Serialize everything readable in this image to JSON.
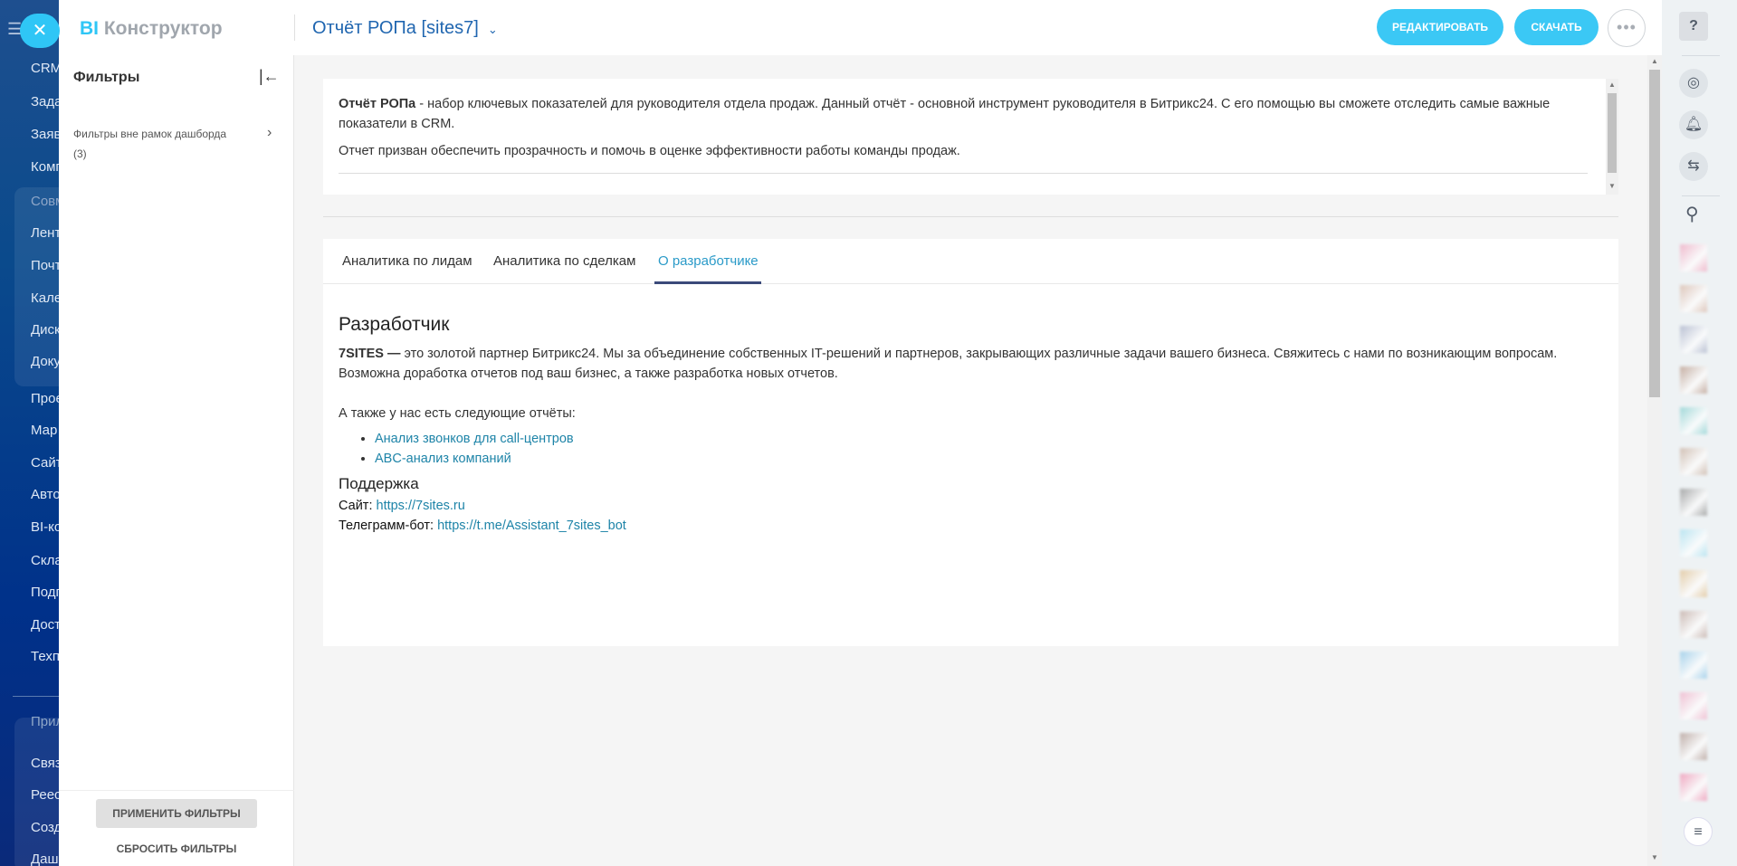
{
  "left_nav": {
    "items": [
      "CRM",
      "Зада",
      "Заяв",
      "Комп",
      "Совм",
      "Лент",
      "Почт",
      "Кале",
      "Диск",
      "Доку",
      "Прое",
      "Мар",
      "Сайт",
      "Авто",
      "BI-ко",
      "Скла",
      "Подп",
      "Дост",
      "Техп",
      "Прил",
      "Связ",
      "Реес",
      "Созд",
      "Даш"
    ]
  },
  "header": {
    "logo_bi": "BI",
    "logo_text": "Конструктор",
    "report_title": "Отчёт РОПа [sites7]",
    "edit_label": "РЕДАКТИРОВАТЬ",
    "download_label": "СКАЧАТЬ",
    "more_label": "•••"
  },
  "filters": {
    "title": "Фильтры",
    "item_label": "Фильтры вне рамок дашборда",
    "item_count": "(3)",
    "apply_label": "ПРИМЕНИТЬ ФИЛЬТРЫ",
    "reset_label": "СБРОСИТЬ ФИЛЬТРЫ"
  },
  "description": {
    "bold": "Отчёт РОПа",
    "p1": " - набор ключевых показателей для руководителя отдела продаж. Данный отчёт - основной инструмент руководителя в Битрикс24. С его помощью вы сможете отследить самые важные показатели в CRM.",
    "p2": "Отчет призван обеспечить прозрачность и помочь в оценке эффективности работы команды продаж."
  },
  "tabs": [
    {
      "label": "Аналитика по лидам"
    },
    {
      "label": "Аналитика по сделкам"
    },
    {
      "label": "О разработчике",
      "active": true
    }
  ],
  "developer": {
    "heading": "Разработчик",
    "company": "7SITES —",
    "intro": " это золотой партнер Битрикс24. Мы за объединение собственных IT-решений и партнеров, закрывающих различные задачи вашего бизнеса. Свяжитесь с нами по возникающим вопросам. Возможна доработка отчетов под ваш бизнес, а также разработка новых отчетов.",
    "reports_intro": "А также у нас есть следующие отчёты:",
    "reports": [
      "Анализ звонков для call-центров",
      "ABC-анализ компаний"
    ],
    "support_heading": "Поддержка",
    "site_label": "Сайт:",
    "site_url": "https://7sites.ru",
    "bot_label": "Телеграмм-бот:",
    "bot_url": "https://t.me/Assistant_7sites_bot"
  },
  "colors": {
    "accent": "#3bc8f5",
    "link": "#1e84a8",
    "title": "#2066b0"
  }
}
